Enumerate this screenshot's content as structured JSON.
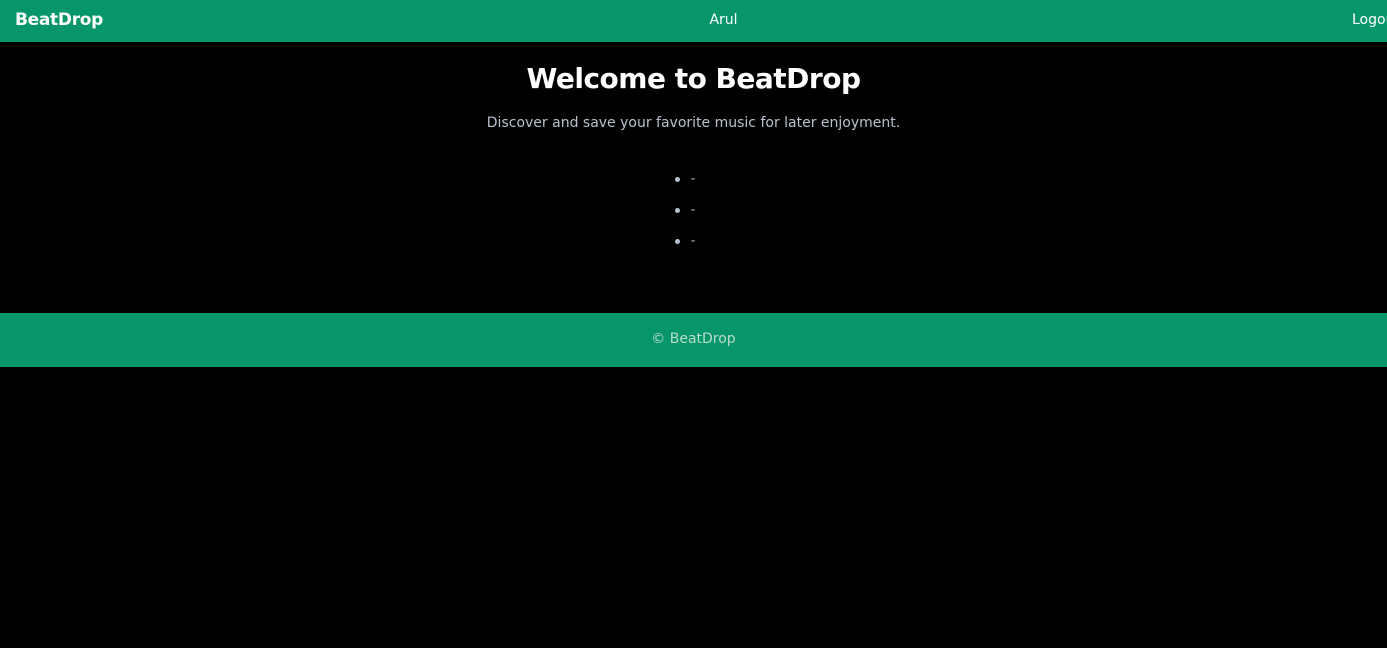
{
  "header": {
    "brand": "BeatDrop",
    "user_name": "Arul",
    "logout_label": "Logout"
  },
  "main": {
    "title": "Welcome to BeatDrop",
    "tagline": "Discover and save your favorite music for later enjoyment.",
    "songs": [
      {
        "text": "-"
      },
      {
        "text": "-"
      },
      {
        "text": "-"
      }
    ]
  },
  "footer": {
    "copyright": "© BeatDrop"
  },
  "colors": {
    "brand_green": "#06966a",
    "background": "#000000",
    "text_primary": "#ffffff",
    "text_muted": "#b8c2cf"
  }
}
